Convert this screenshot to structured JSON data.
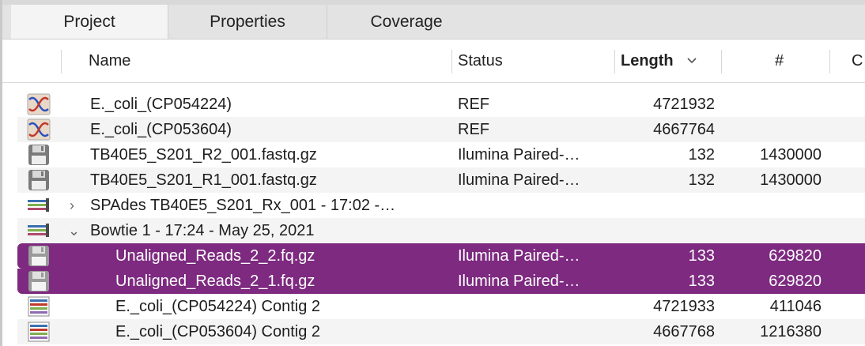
{
  "tabs": [
    {
      "label": "Project"
    },
    {
      "label": "Properties"
    },
    {
      "label": "Coverage"
    }
  ],
  "columns": {
    "name": "Name",
    "status": "Status",
    "length": "Length",
    "count": "#",
    "next": "C"
  },
  "rows": [
    {
      "name": "E._coli_(CP054224)",
      "status": "REF",
      "length": "4721932",
      "count": "",
      "icon": "dna-sequence-icon"
    },
    {
      "name": "E._coli_(CP053604)",
      "status": "REF",
      "length": "4667764",
      "count": "",
      "icon": "dna-sequence-icon"
    },
    {
      "name": "TB40E5_S201_R2_001.fastq.gz",
      "status": "Ilumina Paired-…",
      "length": "132",
      "count": "1430000",
      "icon": "floppy-disk-icon"
    },
    {
      "name": "TB40E5_S201_R1_001.fastq.gz",
      "status": "Ilumina Paired-…",
      "length": "132",
      "count": "1430000",
      "icon": "floppy-disk-icon"
    },
    {
      "name": "SPAdes TB40E5_S201_Rx_001 - 17:02 -…",
      "status": "",
      "length": "",
      "count": "",
      "icon": "assembly-icon",
      "disclosure": "›"
    },
    {
      "name": "Bowtie 1 - 17:24 - May 25, 2021",
      "status": "",
      "length": "",
      "count": "",
      "icon": "assembly-icon",
      "disclosure": "⌄"
    },
    {
      "name": "Unaligned_Reads_2_2.fq.gz",
      "status": "Ilumina Paired-…",
      "length": "133",
      "count": "629820",
      "icon": "floppy-disk-icon"
    },
    {
      "name": "Unaligned_Reads_2_1.fq.gz",
      "status": "Ilumina Paired-…",
      "length": "133",
      "count": "629820",
      "icon": "floppy-disk-icon"
    },
    {
      "name": "E._coli_(CP054224) Contig 2",
      "status": "",
      "length": "4721933",
      "count": "411046",
      "icon": "contig-icon"
    },
    {
      "name": "E._coli_(CP053604) Contig 2",
      "status": "",
      "length": "4667768",
      "count": "1216380",
      "icon": "contig-icon"
    }
  ],
  "colors": {
    "selection": "#7d2a80",
    "tabbar": "#e3e3e3",
    "stripe": "#f4f4f4"
  }
}
